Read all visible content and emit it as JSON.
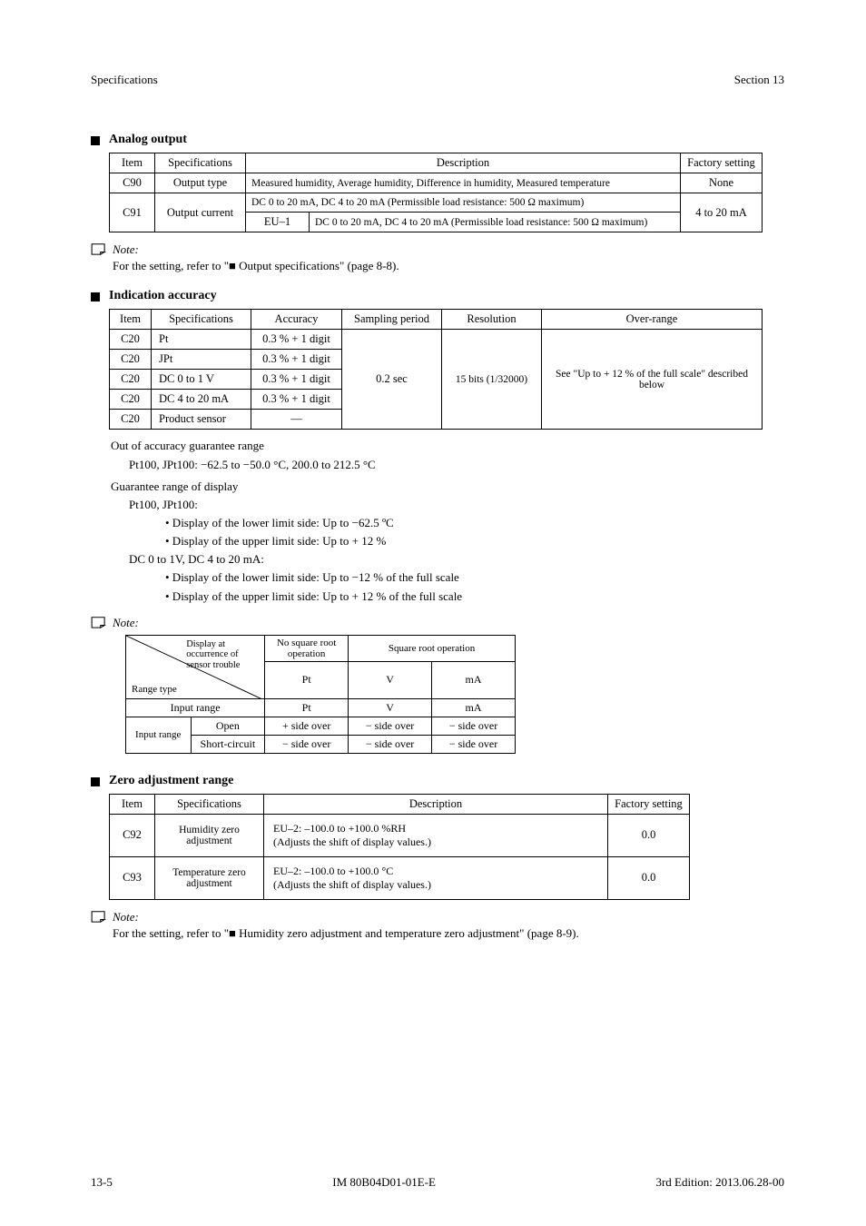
{
  "header": {
    "left": "Specifications",
    "right": "Section 13"
  },
  "sec_analog": {
    "title": "Analog output",
    "th": {
      "item": "Item",
      "spec": "Specifications",
      "desc": "Description",
      "factory": "Factory setting"
    },
    "rows": [
      {
        "item": "C90",
        "spec": "Output type",
        "desc": "Measured humidity, Average humidity, Difference in humidity, Measured temperature",
        "factory": "None"
      },
      {
        "item": "C91",
        "spec": "Output current",
        "sub_item": "EU–1",
        "sub_desc": "DC 0 to 20 mA, DC 4 to 20 mA (Permissible load resistance: 500 Ω maximum)",
        "factory": "4 to 20 mA"
      }
    ],
    "note": {
      "label": "Note:",
      "body": "For the setting, refer to \"■ Output specifications\" (page 8-8)."
    }
  },
  "sec_acc": {
    "title": "Indication accuracy",
    "th": {
      "item": "Item",
      "spec": "Specifications",
      "acc": "Accuracy",
      "period": "Sampling period",
      "res": "Resolution",
      "over": "Over-range"
    },
    "rows": [
      {
        "item": "C20",
        "spec": "Pt",
        "acc": "0.3 % + 1 digit"
      },
      {
        "item": "C20",
        "spec": "JPt",
        "acc": "0.3 % + 1 digit"
      },
      {
        "item": "C20",
        "spec": "DC 0 to 1 V",
        "acc": "0.3 % + 1 digit"
      },
      {
        "item": "C20",
        "spec": "DC 4 to 20 mA",
        "acc": "0.3 % + 1 digit"
      },
      {
        "item": "C20",
        "spec": "Product sensor",
        "acc": "—"
      }
    ],
    "period_val": "0.2 sec",
    "res_val": "15 bits (1/32000)",
    "over_val": "See \"Up to + 12 % of the full scale\" described below",
    "extra": {
      "out_label": "Out of accuracy guarantee range",
      "line1": "Pt100, JPt100: −62.5 to −50.0 °C, 200.0 to 212.5 °C",
      "guar_label": "Guarantee range of display",
      "pt_label": "Pt100, JPt100:",
      "pt_low": "• Display of the lower limit side: Up to −62.5 ºC",
      "pt_high": "• Display of the upper limit side: Up to + 12 %",
      "dc_label": "DC 0 to 1V, DC 4 to 20 mA:",
      "dc_low": "• Display of the lower limit side: Up to −12 % of the full scale",
      "dc_high": "• Display of the upper limit side: Up to + 12 % of the full scale"
    },
    "note_label": "Note:",
    "note_table": {
      "head1": "Display at occurrence of sensor trouble",
      "range_type": "Range type",
      "no_sq": "No square root operation",
      "sq": "Square root operation",
      "cols": [
        "Input range",
        "Pt",
        "V",
        "mA"
      ],
      "rows": [
        {
          "label": "Open",
          "pt": "+ side over",
          "v": "− side over",
          "ma": "− side over"
        },
        {
          "label": "Short-circuit",
          "pt": "− side over",
          "v": "− side over",
          "ma": "− side over"
        }
      ]
    }
  },
  "sec_zero": {
    "title": "Zero adjustment range",
    "th": {
      "item": "Item",
      "spec": "Specifications",
      "desc": "Description",
      "factory": "Factory setting"
    },
    "rows": [
      {
        "item": "C92",
        "spec": "Humidity zero adjustment",
        "desc": "EU–2: –100.0 to +100.0 %RH\n(Adjusts the shift of display values.)",
        "factory": "0.0"
      },
      {
        "item": "C93",
        "spec": "Temperature zero adjustment",
        "desc": "EU–2: –100.0 to +100.0 °C\n(Adjusts the shift of display values.)",
        "factory": "0.0"
      }
    ],
    "note": {
      "label": "Note:",
      "body": "For the setting, refer to \"■ Humidity zero adjustment and temperature zero adjustment\" (page 8-9)."
    }
  },
  "footer": {
    "pagenum": "13-5",
    "doc": "IM 80B04D01-01E-E",
    "edition": "3rd Edition: 2013.06.28-00"
  }
}
